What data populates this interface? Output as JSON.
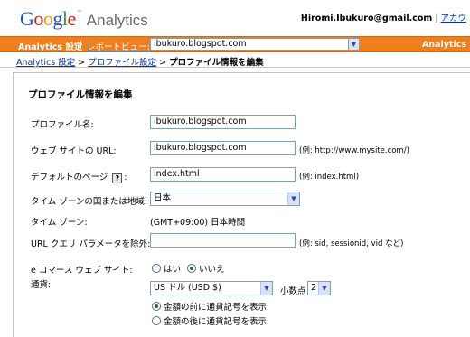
{
  "header": {
    "logo_google": "Google",
    "logo_tm": "™",
    "logo_analytics": "Analytics",
    "email": "Hiromi.Ibukuro@gmail.com",
    "separator": "|",
    "account_link": "アカウ"
  },
  "orange_bar": {
    "settings": "Analytics 設定",
    "separator": "|",
    "report_view": "レポートビュー:",
    "profile_select": "ibukuro.blogspot.com",
    "right_label": "Analytics"
  },
  "breadcrumb": {
    "item1": "Analytics 設定",
    "arrow1": ">",
    "item2": "プロファイル設定",
    "arrow2": ">",
    "current": "プロファイル情報を編集"
  },
  "form": {
    "title": "プロファイル情報を編集",
    "profile_name_label": "プロファイル名:",
    "profile_name_value": "ibukuro.blogspot.com",
    "website_url_label": "ウェブ サイトの URL:",
    "website_url_value": "ibukuro.blogspot.com",
    "website_url_hint": "(例: http://www.mysite.com/)",
    "default_page_label": "デフォルトのページ",
    "default_page_help": "?",
    "default_page_colon": ":",
    "default_page_value": "index.html",
    "default_page_hint": "(例: index.html)",
    "timezone_country_label": "タイム ゾーンの国または地域:",
    "timezone_country_value": "日本",
    "timezone_label": "タイム ゾーン:",
    "timezone_value": "(GMT+09:00) 日本時間",
    "exclude_params_label": "URL クエリ パラメータを除外:",
    "exclude_params_value": "",
    "exclude_params_hint": "(例: sid, sessionid, vid など)",
    "ecommerce_label": "e コマース ウェブ サイト:",
    "ecommerce_yes": "はい",
    "ecommerce_no": "いいえ",
    "currency_label": "通貨:",
    "currency_value": "US ドル (USD $)",
    "decimal_label": "小数点",
    "decimal_value": "2",
    "symbol_before": "金額の前に通貨記号を表示",
    "symbol_after": "金額の後に通貨記号を表示"
  }
}
